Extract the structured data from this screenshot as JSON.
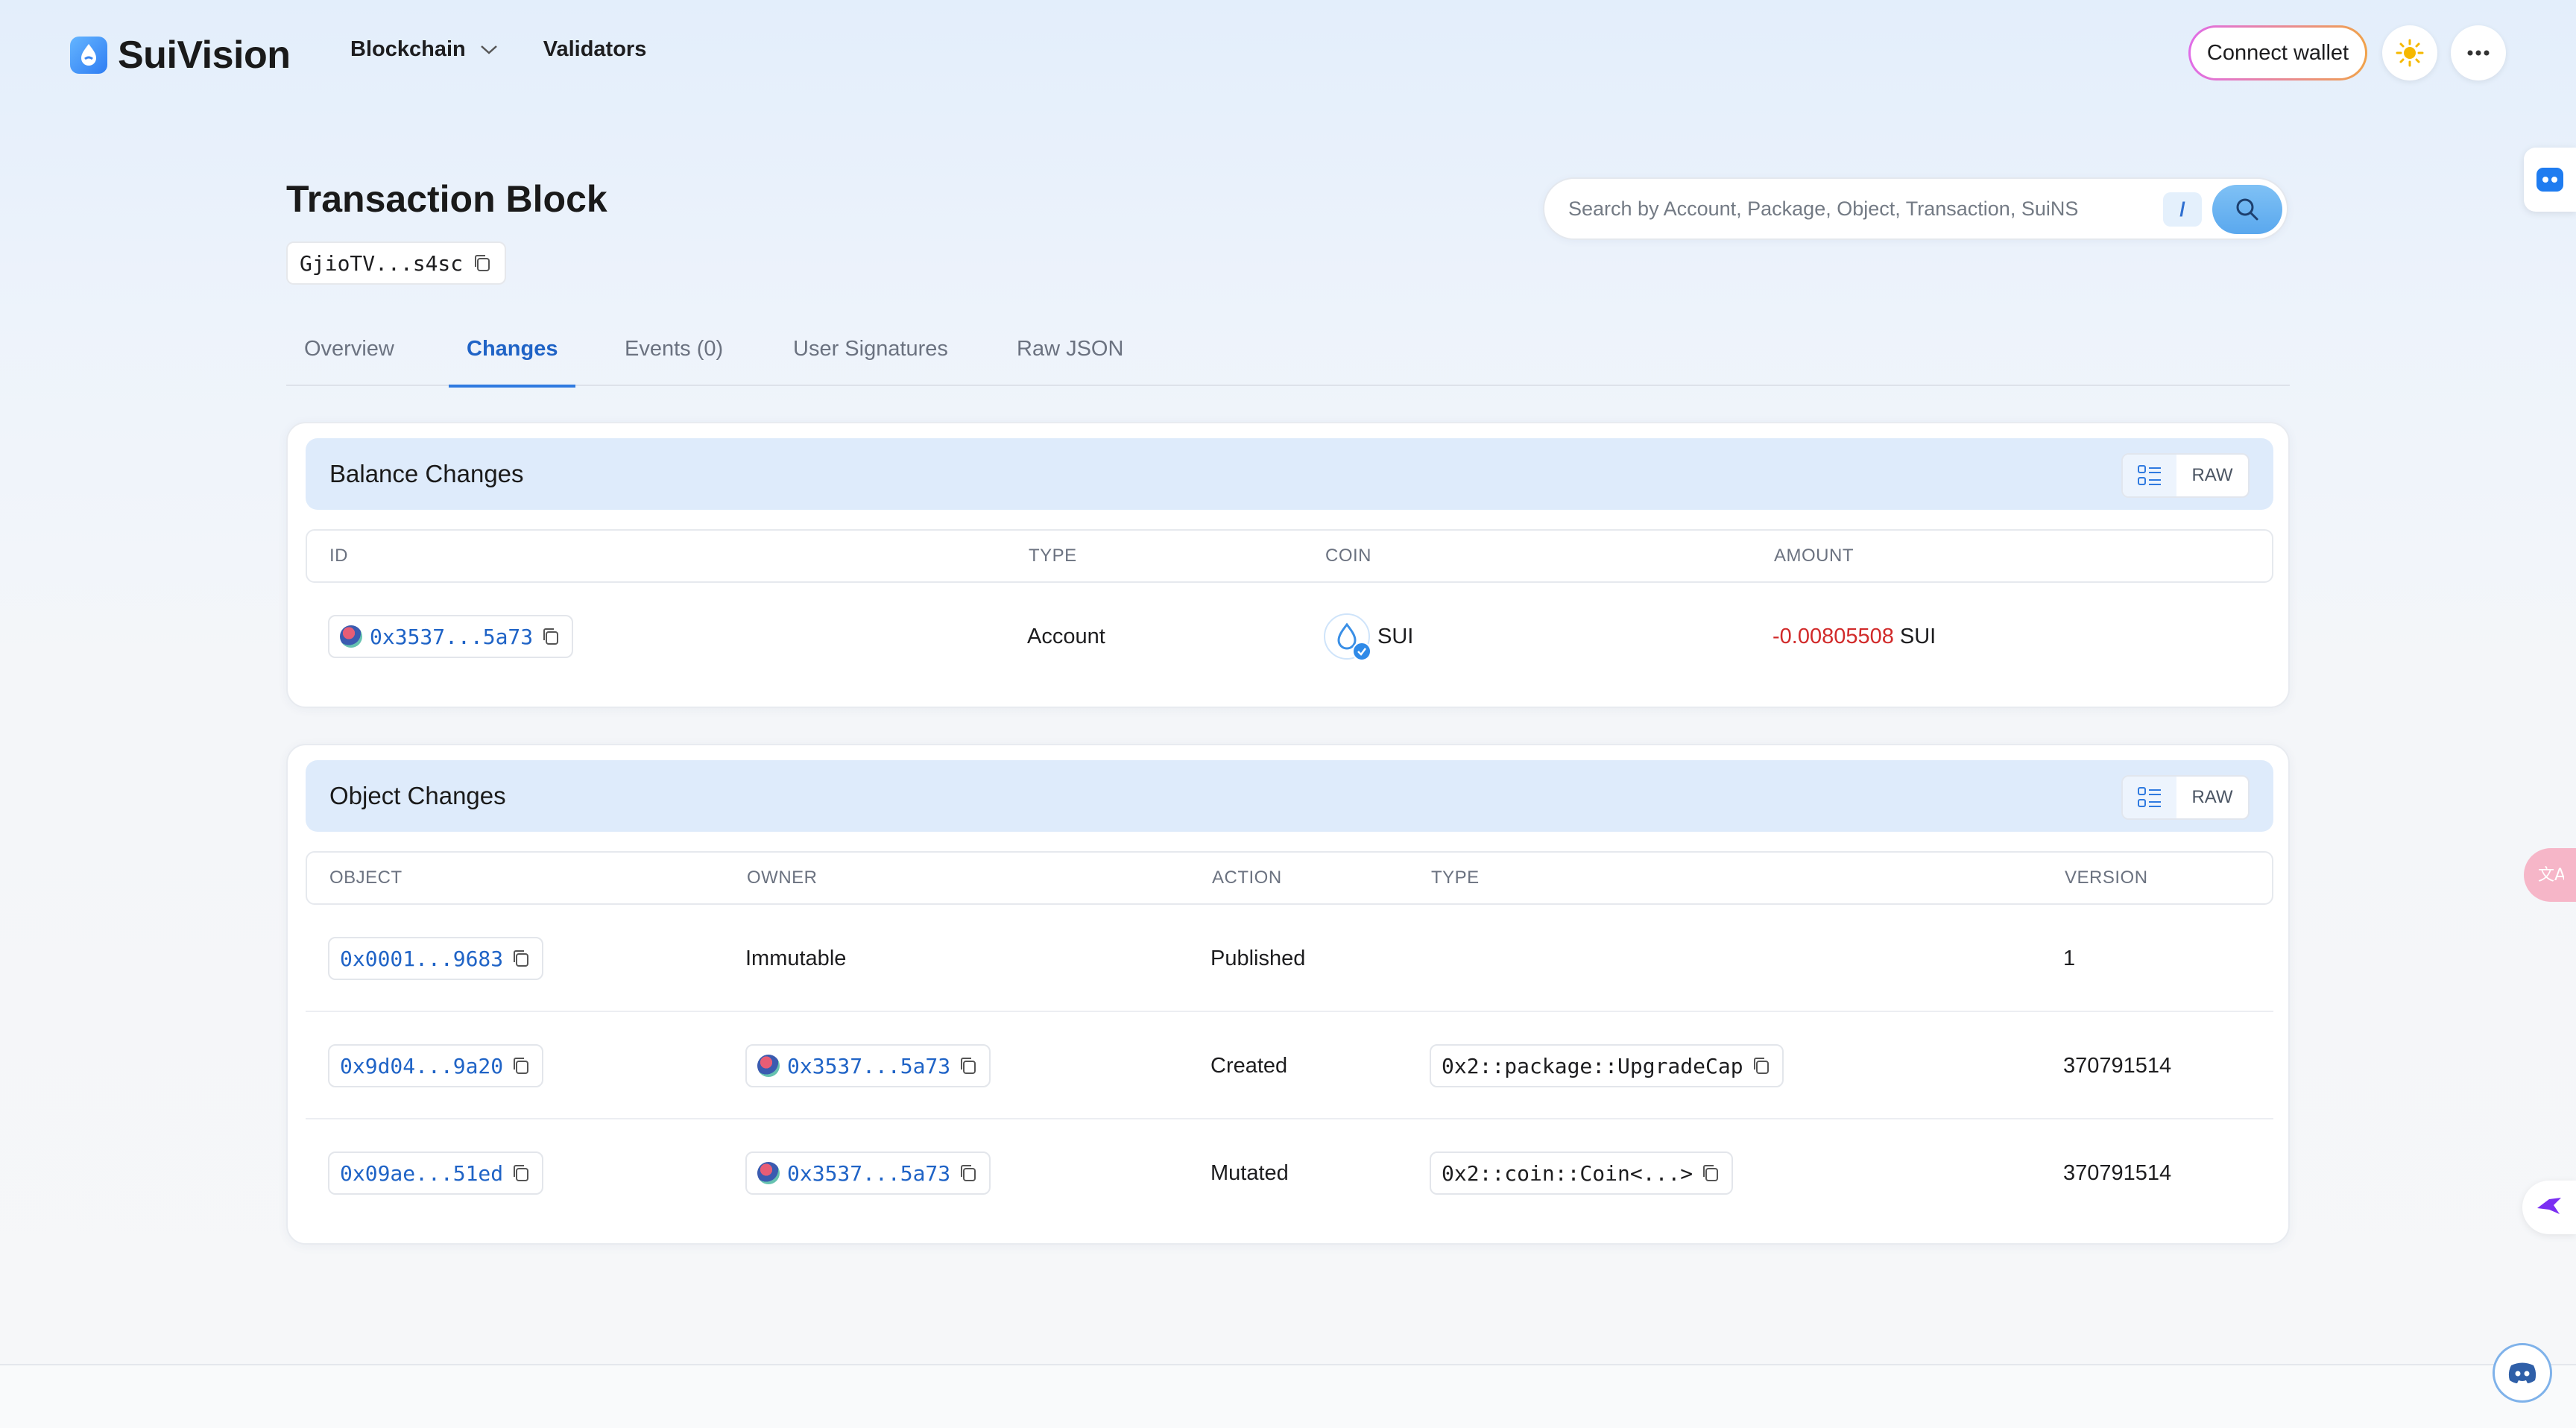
{
  "brand": {
    "name": "SuiVision"
  },
  "nav": {
    "blockchain": "Blockchain",
    "validators": "Validators"
  },
  "header": {
    "connect_wallet": "Connect wallet"
  },
  "page": {
    "title": "Transaction Block",
    "tx_hash": "GjioTV...s4sc"
  },
  "search": {
    "placeholder": "Search by Account, Package, Object, Transaction, SuiNS",
    "shortcut": "/"
  },
  "tabs": [
    {
      "label": "Overview"
    },
    {
      "label": "Changes"
    },
    {
      "label": "Events (0)"
    },
    {
      "label": "User Signatures"
    },
    {
      "label": "Raw JSON"
    }
  ],
  "active_tab": "Changes",
  "balance_changes": {
    "title": "Balance Changes",
    "raw_label": "RAW",
    "columns": {
      "id": "ID",
      "type": "TYPE",
      "coin": "COIN",
      "amount": "AMOUNT"
    },
    "rows": [
      {
        "id": "0x3537...5a73",
        "type": "Account",
        "coin": "SUI",
        "amount": "-0.00805508",
        "amount_unit": "SUI"
      }
    ]
  },
  "object_changes": {
    "title": "Object Changes",
    "raw_label": "RAW",
    "columns": {
      "object": "OBJECT",
      "owner": "OWNER",
      "action": "ACTION",
      "type": "TYPE",
      "version": "VERSION"
    },
    "rows": [
      {
        "object": "0x0001...9683",
        "owner": "Immutable",
        "action": "Published",
        "type": "",
        "version": "1"
      },
      {
        "object": "0x9d04...9a20",
        "owner": "0x3537...5a73",
        "action": "Created",
        "type": "0x2::package::UpgradeCap",
        "version": "370791514"
      },
      {
        "object": "0x09ae...51ed",
        "owner": "0x3537...5a73",
        "action": "Mutated",
        "type": "0x2::coin::Coin<...>",
        "version": "370791514"
      }
    ]
  },
  "colors": {
    "accent": "#1f63c6",
    "negative": "#d12a2a",
    "card_header": "#deebfb"
  },
  "icons": [
    "sui-logo-icon",
    "chevron-down-icon",
    "sun-icon",
    "more-icon",
    "copy-icon",
    "search-icon",
    "list-view-icon",
    "sui-coin-icon",
    "verified-check-icon",
    "translate-icon",
    "bird-icon",
    "discord-icon"
  ]
}
